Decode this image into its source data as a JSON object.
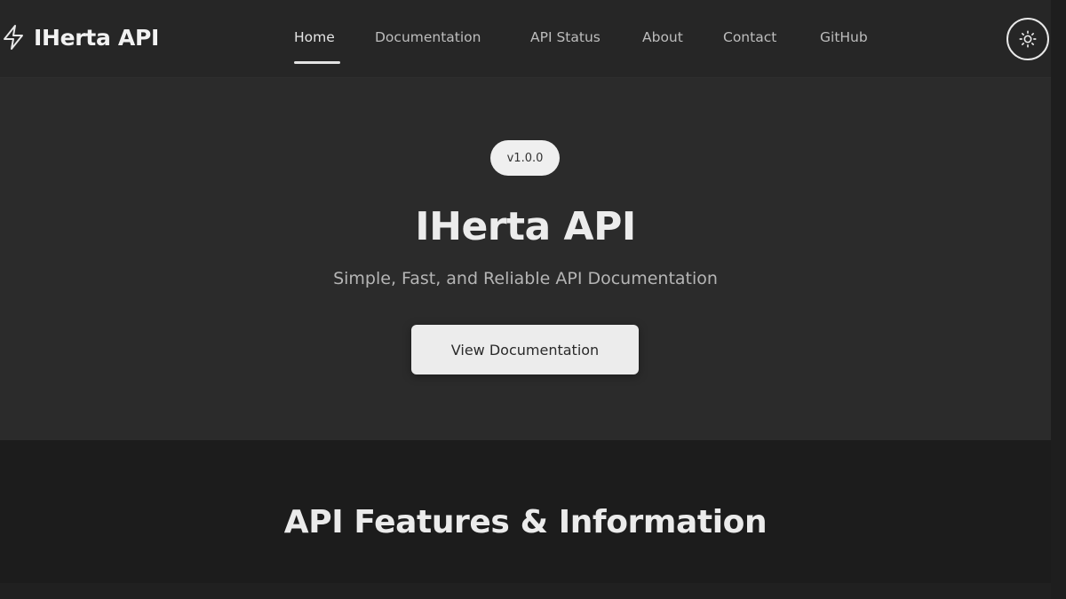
{
  "brand": {
    "name": "IHerta API",
    "icon": "lightning-bolt-icon"
  },
  "nav": {
    "active": "Home",
    "links": [
      "Home",
      "Documentation",
      "API Status",
      "About",
      "Contact",
      "GitHub"
    ]
  },
  "theme_toggle": {
    "icon": "sun-icon"
  },
  "hero": {
    "version": "v1.0.0",
    "title": "IHerta API",
    "subtitle": "Simple, Fast, and Reliable API Documentation",
    "cta_label": "View Documentation"
  },
  "features": {
    "title": "API Features & Information"
  },
  "colors": {
    "navbar_bg": "#262626",
    "hero_bg": "#2b2b2b",
    "section_bg": "#1c1c1c",
    "button_bg": "#ececec",
    "accent_text": "#ececec"
  }
}
